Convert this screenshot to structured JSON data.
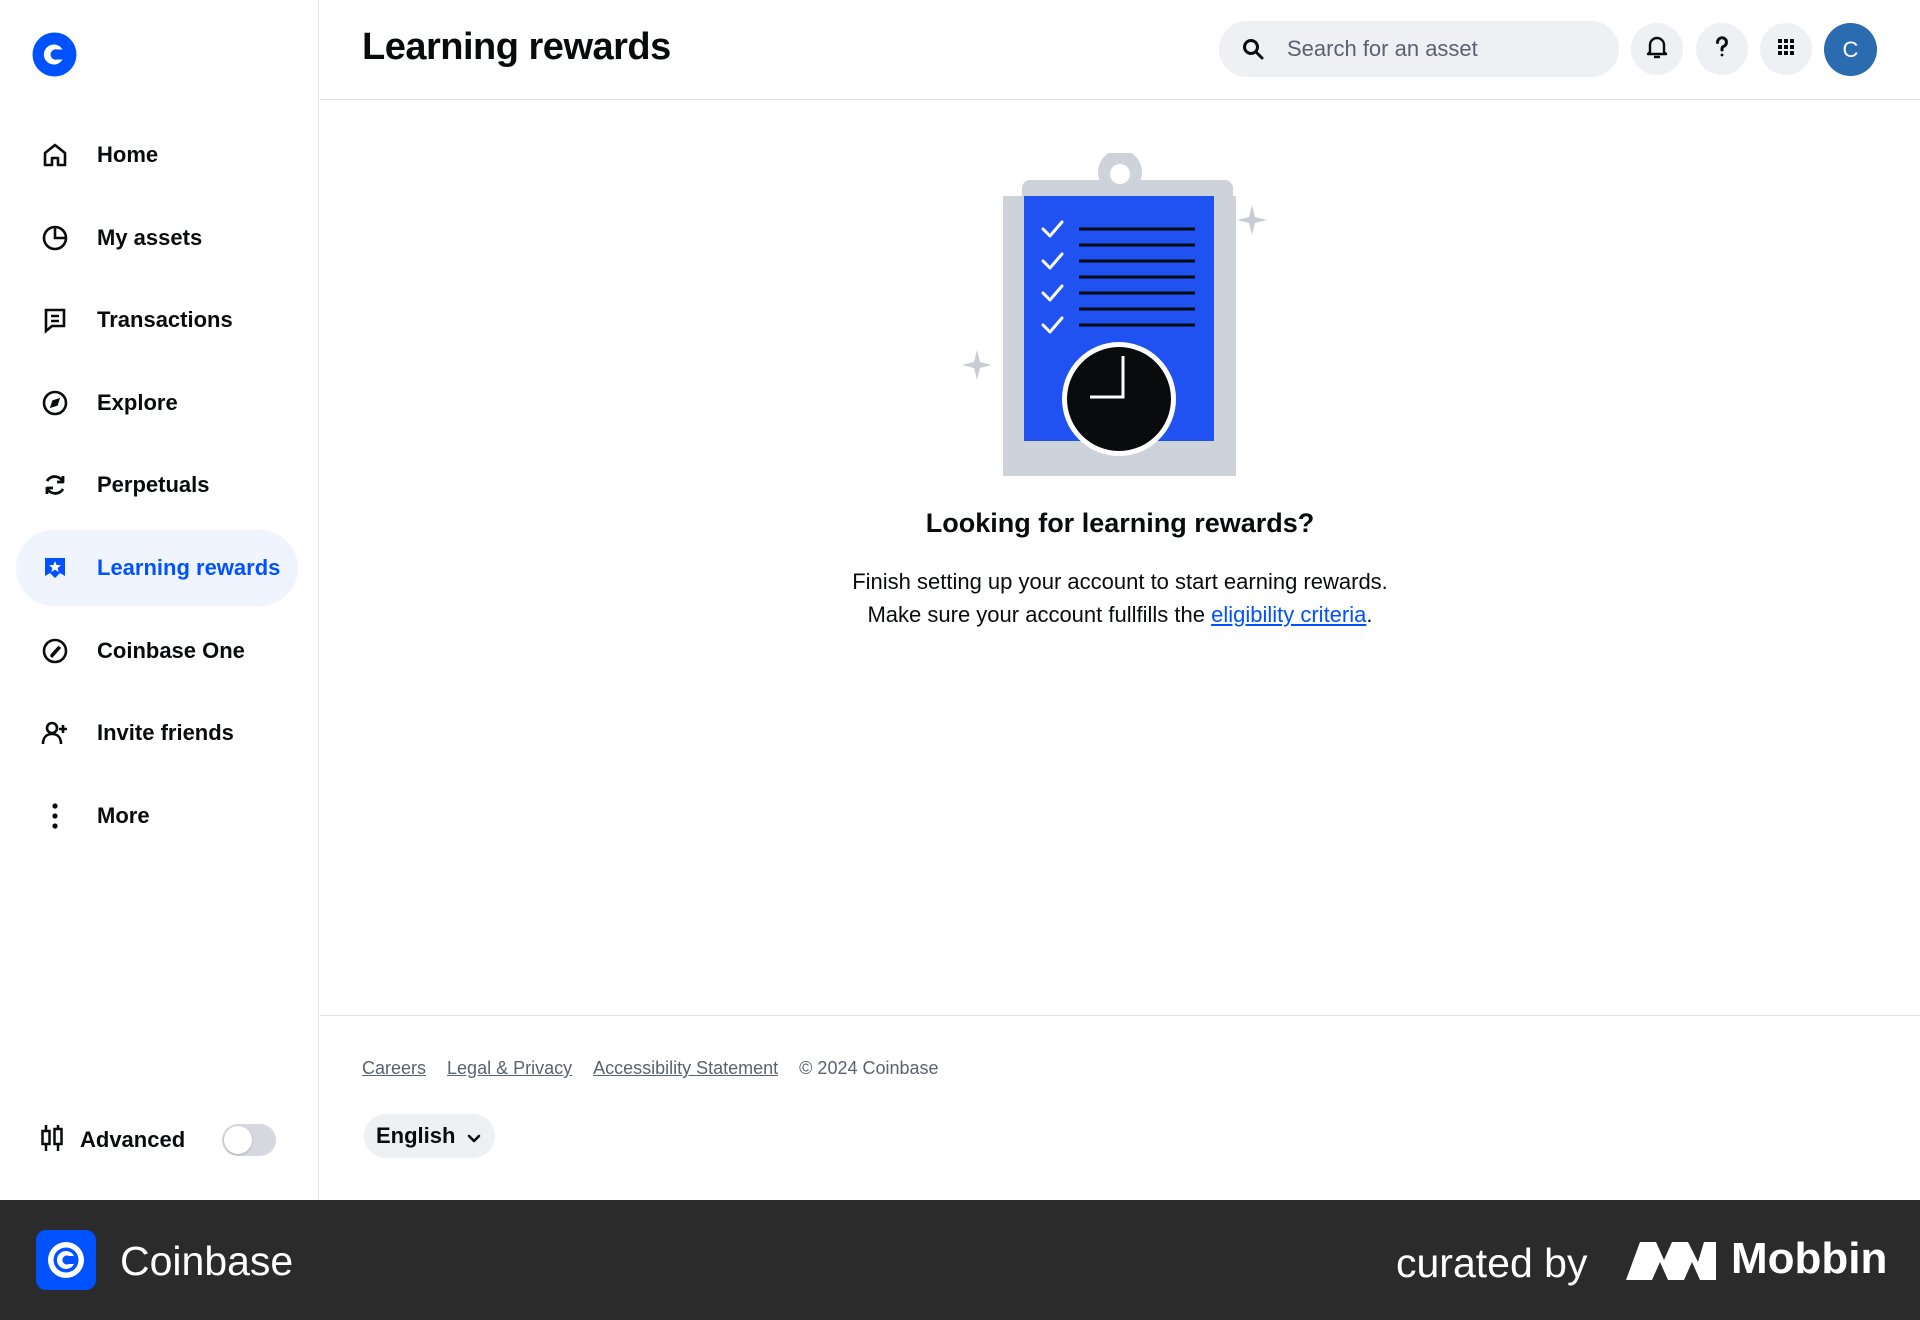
{
  "app": {
    "name": "Coinbase",
    "brand_color": "#0052ff"
  },
  "sidebar": {
    "items": [
      {
        "label": "Home",
        "icon": "home-icon",
        "active": false
      },
      {
        "label": "My assets",
        "icon": "pie-chart-icon",
        "active": false
      },
      {
        "label": "Transactions",
        "icon": "receipt-icon",
        "active": false
      },
      {
        "label": "Explore",
        "icon": "compass-icon",
        "active": false
      },
      {
        "label": "Perpetuals",
        "icon": "refresh-icon",
        "active": false
      },
      {
        "label": "Learning rewards",
        "icon": "rewards-badge-icon",
        "active": true
      },
      {
        "label": "Coinbase One",
        "icon": "coinbase-one-icon",
        "active": false
      },
      {
        "label": "Invite friends",
        "icon": "add-user-icon",
        "active": false
      },
      {
        "label": "More",
        "icon": "more-vertical-icon",
        "active": false
      }
    ],
    "advanced": {
      "label": "Advanced",
      "enabled": false
    }
  },
  "header": {
    "title": "Learning rewards",
    "search_placeholder": "Search for an asset",
    "avatar_initial": "C"
  },
  "main": {
    "empty_title": "Looking for learning rewards?",
    "empty_line1": "Finish setting up your account to start earning rewards.",
    "empty_line2_prefix": "Make sure your account fullfills the ",
    "empty_link": "eligibility criteria",
    "empty_line2_suffix": "."
  },
  "footer": {
    "links": [
      "Careers",
      "Legal & Privacy",
      "Accessibility Statement"
    ],
    "copyright": "© 2024 Coinbase",
    "language": "English"
  },
  "banner": {
    "app_name": "Coinbase",
    "curated_by": "curated by",
    "curator": "Mobbin"
  }
}
